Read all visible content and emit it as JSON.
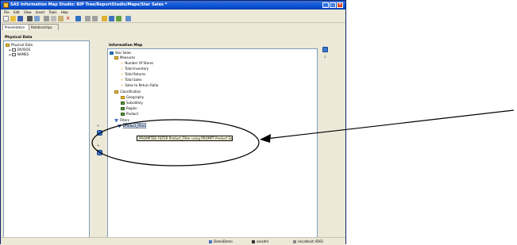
{
  "window": {
    "title": "SAS Information Map Studio: BIP Tree/ReportStudio/Maps/Star Sales *"
  },
  "menu": [
    "File",
    "Edit",
    "View",
    "Insert",
    "Tools",
    "Help"
  ],
  "tabs": [
    {
      "label": "Presentation",
      "active": true
    },
    {
      "label": "Relationships",
      "active": false
    }
  ],
  "left_pane": {
    "title": "Physical Data",
    "items": [
      {
        "label": "Physical Data",
        "icon": "folder-icon",
        "indent": 0
      },
      {
        "label": "DIVISOS",
        "icon": "table-icon",
        "indent": 1
      },
      {
        "label": "NAMES",
        "icon": "table-icon",
        "indent": 1
      }
    ]
  },
  "right_pane": {
    "title": "Information Map",
    "items": [
      {
        "label": "Star Sales",
        "icon": "info-map-icon",
        "indent": 0
      },
      {
        "label": "Measures",
        "icon": "folder-icon",
        "indent": 1
      },
      {
        "label": "Number Of Stores",
        "icon": "measure-icon",
        "indent": 2
      },
      {
        "label": "Total Inventory",
        "icon": "measure-icon",
        "indent": 2
      },
      {
        "label": "Total Returns",
        "icon": "measure-icon",
        "indent": 2
      },
      {
        "label": "Total Sales",
        "icon": "measure-icon",
        "indent": 2
      },
      {
        "label": "Sales to Return Ratio",
        "icon": "measure-icon",
        "indent": 2
      },
      {
        "label": "Classification",
        "icon": "folder-icon",
        "indent": 1
      },
      {
        "label": "Geography",
        "icon": "folder-icon",
        "indent": 2
      },
      {
        "label": "Subsidiary",
        "icon": "category-icon",
        "indent": 2
      },
      {
        "label": "Region",
        "icon": "category-icon",
        "indent": 2
      },
      {
        "label": "Product",
        "icon": "category-icon",
        "indent": 2
      },
      {
        "label": "Filters",
        "icon": "filter-icon",
        "indent": 1
      },
      {
        "label": "Product_Filter",
        "icon": "filter-icon",
        "indent": 2,
        "selected": true
      }
    ],
    "tooltip": "PROMPTED FILTER Product_Filter using PROMPT Product Select"
  },
  "status_bar": {
    "items": [
      "DemoDemo",
      "sassdm",
      "(localhost: 8561"
    ]
  },
  "annotations": {
    "callout": "ellipse-and-arrow"
  }
}
